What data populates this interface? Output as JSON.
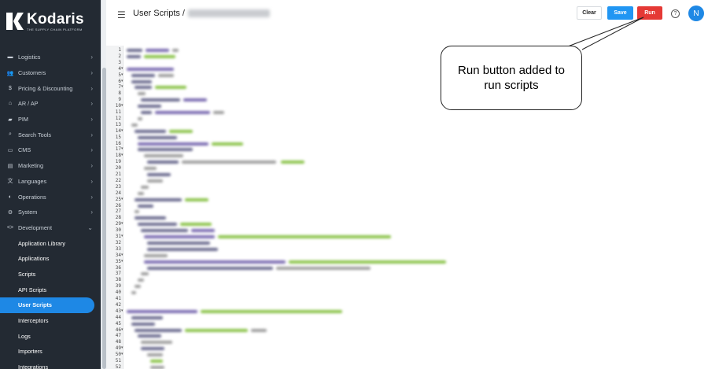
{
  "brand": {
    "name": "Kodaris",
    "tagline": "THE SUPPLY CHAIN PLATFORM"
  },
  "sidebar": {
    "items": [
      {
        "label": "Logistics",
        "icon": "truck-icon",
        "glyph": "▬"
      },
      {
        "label": "Customers",
        "icon": "people-icon",
        "glyph": "👥"
      },
      {
        "label": "Pricing & Discounting",
        "icon": "dollar-icon",
        "glyph": "$"
      },
      {
        "label": "AR / AP",
        "icon": "bank-icon",
        "glyph": "⌂"
      },
      {
        "label": "PIM",
        "icon": "folder-icon",
        "glyph": "▰"
      },
      {
        "label": "Search Tools",
        "icon": "search-icon",
        "glyph": "⌕"
      },
      {
        "label": "CMS",
        "icon": "monitor-icon",
        "glyph": "▭"
      },
      {
        "label": "Marketing",
        "icon": "newspaper-icon",
        "glyph": "▤"
      },
      {
        "label": "Languages",
        "icon": "translate-icon",
        "glyph": "文"
      },
      {
        "label": "Operations",
        "icon": "operations-icon",
        "glyph": "◐"
      },
      {
        "label": "System",
        "icon": "gear-icon",
        "glyph": "⚙"
      },
      {
        "label": "Development",
        "icon": "code-icon",
        "glyph": "<>"
      }
    ],
    "development_items": [
      {
        "label": "Application Library",
        "active": false
      },
      {
        "label": "Applications",
        "active": false
      },
      {
        "label": "Scripts",
        "active": false
      },
      {
        "label": "API Scripts",
        "active": false
      },
      {
        "label": "User Scripts",
        "active": true
      },
      {
        "label": "Interceptors",
        "active": false
      },
      {
        "label": "Logs",
        "active": false
      },
      {
        "label": "Importers",
        "active": false
      },
      {
        "label": "Integrations",
        "active": false
      }
    ]
  },
  "header": {
    "title": "User Scripts",
    "separator": "/",
    "clear_label": "Clear",
    "save_label": "Save",
    "run_label": "Run",
    "help_glyph": "?",
    "avatar_initial": "N"
  },
  "editor": {
    "line_numbers": [
      "1",
      "2",
      "3",
      "4",
      "5",
      "6",
      "7",
      "8",
      "9",
      "10",
      "11",
      "12",
      "13",
      "14",
      "15",
      "16",
      "17",
      "18",
      "19",
      "20",
      "21",
      "22",
      "23",
      "24",
      "25",
      "26",
      "27",
      "28",
      "29",
      "30",
      "31",
      "32",
      "33",
      "34",
      "35",
      "36",
      "37",
      "38",
      "39",
      "40",
      "41",
      "42",
      "43",
      "44",
      "45",
      "46",
      "47",
      "48",
      "49",
      "50",
      "51",
      "52"
    ],
    "fold_lines": [
      "4",
      "5",
      "6",
      "7",
      "10",
      "14",
      "17",
      "18",
      "25",
      "29",
      "31",
      "34",
      "35",
      "43",
      "46",
      "49",
      "50"
    ]
  },
  "callout": {
    "text": "Run button added to run scripts"
  },
  "colors": {
    "sidebar_bg": "#232a33",
    "active_item": "#1e88e5",
    "save_button": "#2196f3",
    "run_button": "#e53935"
  }
}
